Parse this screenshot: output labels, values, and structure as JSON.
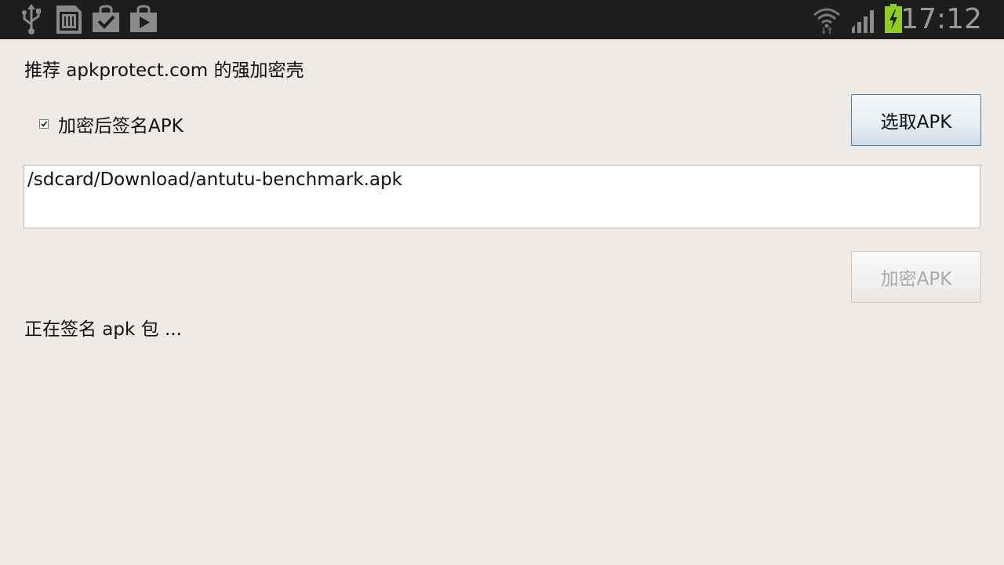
{
  "statusbar": {
    "left_icons": [
      "usb-icon",
      "sd-card-icon",
      "play-store-check-icon",
      "play-store-icon"
    ],
    "right_icons": [
      "wifi-icon",
      "signal-icon",
      "battery-charging-icon"
    ],
    "time": "17:12",
    "battery_color": "#8fcd1e",
    "icon_color": "#8a8a8a"
  },
  "main": {
    "recommend_text": "推荐 apkprotect.com 的强加密壳",
    "sign_checkbox": {
      "label": "加密后签名APK",
      "checked": true
    },
    "select_button_label": "选取APK",
    "apk_path": "/sdcard/Download/antutu-benchmark.apk",
    "encrypt_button_label": "加密APK",
    "encrypt_button_enabled": false,
    "status_message": "正在签名 apk 包 ..."
  }
}
